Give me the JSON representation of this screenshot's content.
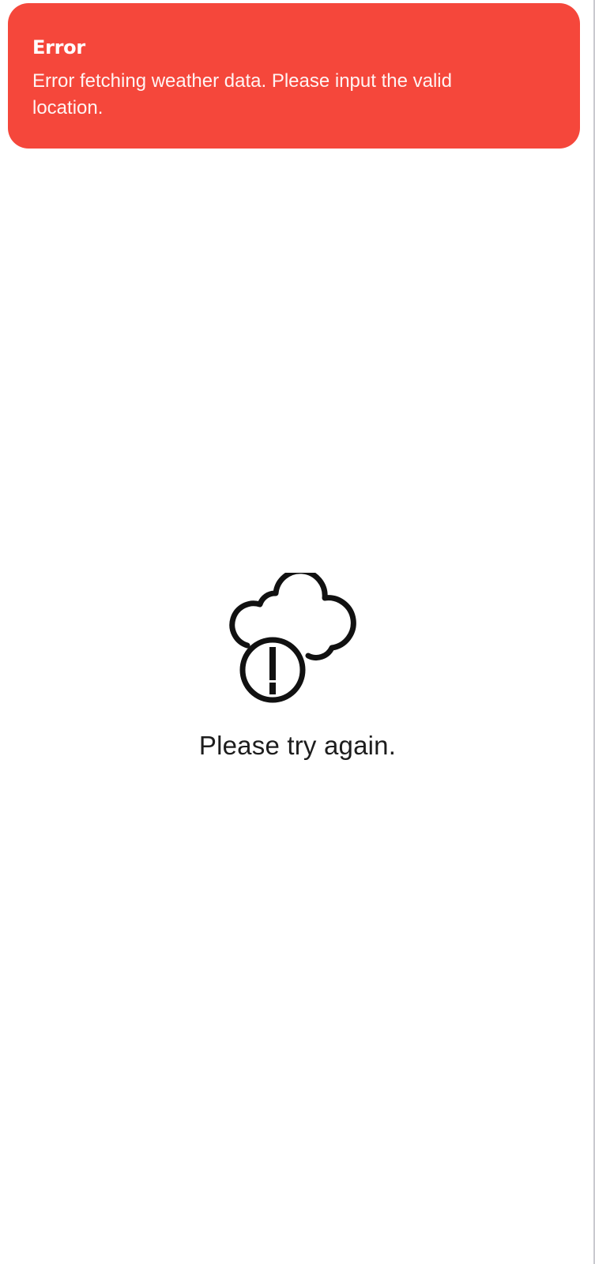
{
  "toast": {
    "title": "Error",
    "message": "Error fetching weather data. Please input the valid location.",
    "background_color": "#f5473b"
  },
  "empty_state": {
    "icon": "cloud-alert-icon",
    "message": "Please try again."
  }
}
